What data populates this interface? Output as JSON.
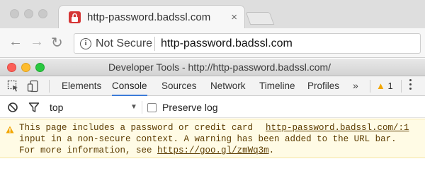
{
  "browser": {
    "tab_title": "http-password.badssl.com",
    "tab_close": "×",
    "security_label": "Not Secure",
    "url": "http-password.badssl.com",
    "icons": [
      "back-arrow-icon",
      "forward-arrow-icon",
      "reload-icon",
      "info-icon",
      "lock-favicon"
    ]
  },
  "devtools": {
    "title": "Developer Tools - http://http-password.badssl.com/",
    "tabs": [
      "Elements",
      "Console",
      "Sources",
      "Network",
      "Timeline",
      "Profiles"
    ],
    "active_tab": "Console",
    "more_tabs": "»",
    "warning_count": "1",
    "console": {
      "context": "top",
      "preserve_log_label": "Preserve log",
      "preserve_log_checked": false,
      "warning": {
        "line1": "This page includes a password or credit card",
        "source": "http-password.badssl.com/:1",
        "line2": "input in a non-secure context. A warning has been added to the URL bar.",
        "line3_prefix": "For more information, see ",
        "link": "https://goo.gl/zmWq3m",
        "line3_suffix": "."
      }
    }
  },
  "colors": {
    "accent": "#3c7bd9",
    "warning_bg": "#fffbe5",
    "warning_text": "#5c3c00",
    "warning_icon": "#f2a600",
    "favicon": "#d53636"
  }
}
